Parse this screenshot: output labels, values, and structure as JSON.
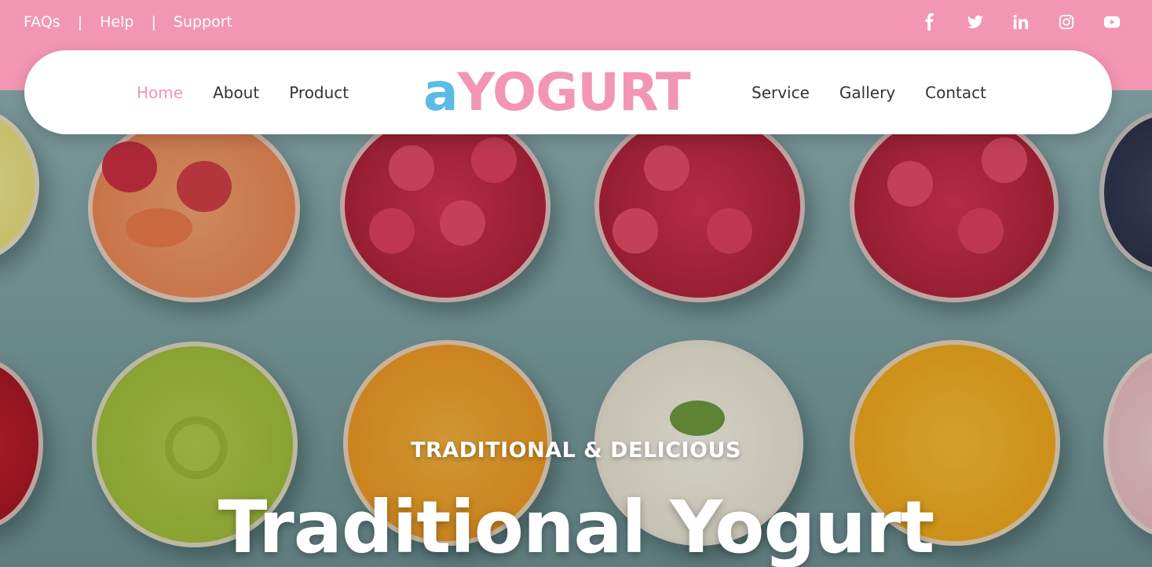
{
  "topbar": {
    "links": [
      "FAQs",
      "Help",
      "Support"
    ],
    "separator": "|",
    "social_icons": [
      "facebook-icon",
      "twitter-icon",
      "linkedin-icon",
      "instagram-icon",
      "youtube-icon"
    ]
  },
  "nav": {
    "left_items": [
      "Home",
      "About",
      "Product"
    ],
    "right_items": [
      "Service",
      "Gallery",
      "Contact"
    ],
    "active_item": "Home"
  },
  "logo": {
    "prefix": "a",
    "name": "YOGURT"
  },
  "hero": {
    "tagline": "TRADITIONAL & DELICIOUS",
    "headline": "Traditional Yogurt"
  },
  "colors": {
    "brand_pink": "#f296b3",
    "brand_blue": "#5bbbe6",
    "nav_text": "#333333",
    "white": "#ffffff"
  }
}
